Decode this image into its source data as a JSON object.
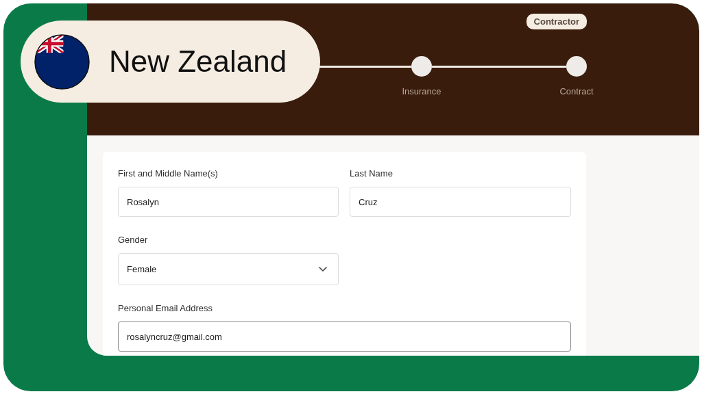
{
  "overlay": {
    "country": "New Zealand"
  },
  "badge": "Contractor",
  "steps": [
    {
      "label": "Insurance"
    },
    {
      "label": "Contract"
    }
  ],
  "form": {
    "fields": [
      {
        "kind": "text",
        "label": "First and Middle Name(s)",
        "value": "Rosalyn",
        "focused": false,
        "wide": false
      },
      {
        "kind": "text",
        "label": "Last Name",
        "value": "Cruz",
        "focused": false,
        "wide": false
      },
      {
        "kind": "select",
        "label": "Gender",
        "value": "Female",
        "focused": false,
        "wide": false
      },
      {
        "kind": "text",
        "label": "Personal Email Address",
        "value": "rosalyncruz@gmail.com",
        "focused": true,
        "wide": true
      }
    ]
  }
}
